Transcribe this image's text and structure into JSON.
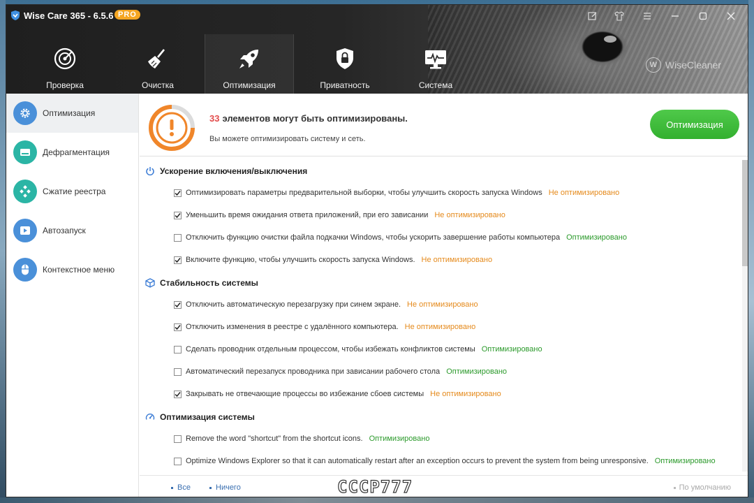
{
  "window": {
    "title": "Wise Care 365 - 6.5.6",
    "badge": "PRO"
  },
  "nav": [
    {
      "label": "Проверка",
      "icon": "radar-icon"
    },
    {
      "label": "Очистка",
      "icon": "broom-icon"
    },
    {
      "label": "Оптимизация",
      "icon": "rocket-icon"
    },
    {
      "label": "Приватность",
      "icon": "privacy-lock-icon"
    },
    {
      "label": "Система",
      "icon": "monitor-pulse-icon"
    }
  ],
  "brand": {
    "letter": "W",
    "name": "WiseCleaner"
  },
  "sidebar": {
    "items": [
      {
        "label": "Оптимизация",
        "icon": "gear-icon",
        "color": "#4a90d9"
      },
      {
        "label": "Дефрагментация",
        "icon": "disk-icon",
        "color": "#2bb5a5"
      },
      {
        "label": "Сжатие реестра",
        "icon": "registry-icon",
        "color": "#2bb5a5"
      },
      {
        "label": "Автозапуск",
        "icon": "play-icon",
        "color": "#4a90d9"
      },
      {
        "label": "Контекстное меню",
        "icon": "mouse-icon",
        "color": "#4a90d9"
      }
    ]
  },
  "banner": {
    "count": "33",
    "title": "элементов могут быть оптимизированы.",
    "subtitle": "Вы можете оптимизировать систему и сеть.",
    "button": "Оптимизация"
  },
  "status_labels": {
    "not_optimized": "Не оптимизировано",
    "optimized": "Оптимизировано"
  },
  "sections": [
    {
      "title": "Ускорение включения/выключения",
      "icon": "power-icon",
      "items": [
        {
          "text": "Оптимизировать параметры предварительной выборки, чтобы улучшить скорость запуска Windows",
          "checked": true,
          "status": "Не оптимизировано"
        },
        {
          "text": "Уменьшить время ожидания ответа приложений, при его зависании",
          "checked": true,
          "status": "Не оптимизировано"
        },
        {
          "text": "Отключить функцию очистки файла подкачки Windows, чтобы ускорить завершение работы компьютера",
          "checked": false,
          "status": "Оптимизировано"
        },
        {
          "text": "Включите функцию, чтобы улучшить скорость запуска Windows.",
          "checked": true,
          "status": "Не оптимизировано"
        }
      ]
    },
    {
      "title": "Стабильность системы",
      "icon": "cube-icon",
      "items": [
        {
          "text": "Отключить автоматическую перезагрузку при синем экране.",
          "checked": true,
          "status": "Не оптимизировано"
        },
        {
          "text": "Отключить изменения в реестре с удалённого компьютера.",
          "checked": true,
          "status": "Не оптимизировано"
        },
        {
          "text": "Сделать проводник отдельным процессом, чтобы избежать конфликтов системы",
          "checked": false,
          "status": "Оптимизировано"
        },
        {
          "text": "Автоматический перезапуск проводника при зависании рабочего стола",
          "checked": false,
          "status": "Оптимизировано"
        },
        {
          "text": "Закрывать не отвечающие процессы во избежание сбоев системы",
          "checked": true,
          "status": "Не оптимизировано"
        }
      ]
    },
    {
      "title": "Оптимизация системы",
      "icon": "speedometer-icon",
      "items": [
        {
          "text": "Remove the word \"shortcut\" from the shortcut icons.",
          "checked": false,
          "status": "Оптимизировано"
        },
        {
          "text": "Optimize Windows Explorer so that it can automatically restart after an exception occurs to prevent the system from being unresponsive.",
          "checked": false,
          "status": "Оптимизировано"
        }
      ]
    }
  ],
  "footer": {
    "all": "Все",
    "none": "Ничего",
    "default": "По умолчанию",
    "watermark": "CCCP777"
  },
  "colors": {
    "accent_green": "#3db838",
    "warn_orange": "#f0862a",
    "status_not_optimized": "#e58a1c",
    "status_optimized": "#2c9a2c",
    "count_red": "#e24c4c"
  }
}
